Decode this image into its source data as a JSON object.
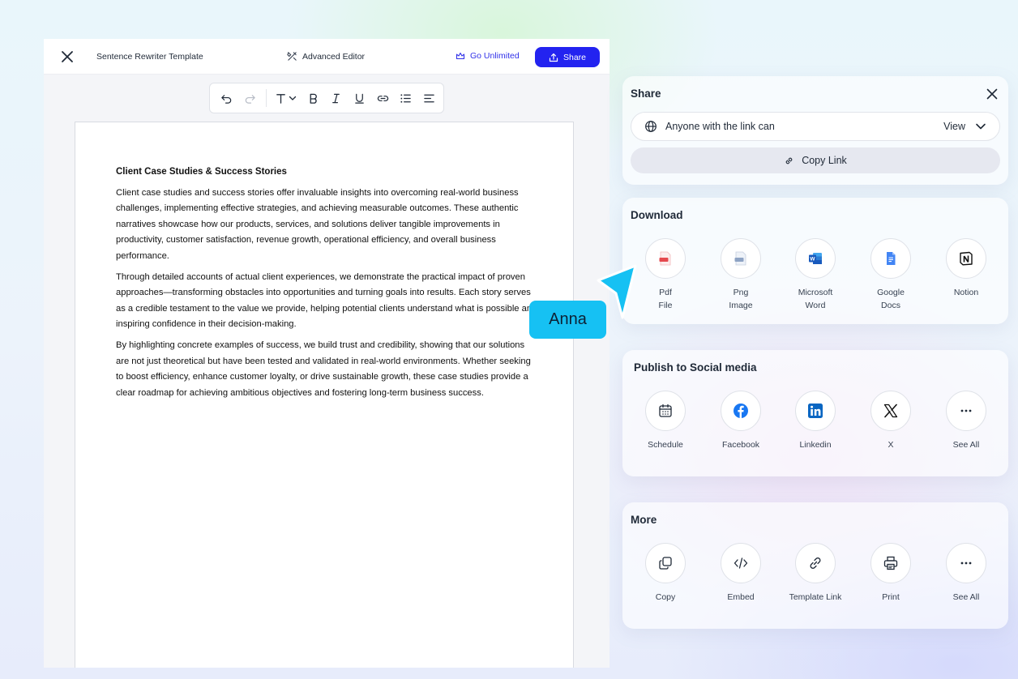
{
  "editor": {
    "doc_title": "Sentence Rewriter Template",
    "advanced_editor": "Advanced Editor",
    "go_unlimited": "Go Unlimited",
    "share": "Share"
  },
  "document": {
    "heading": "Client Case Studies & Success Stories",
    "paragraphs": [
      "Client case studies and success stories offer invaluable insights into overcoming real-world business challenges, implementing effective strategies, and achieving measurable outcomes. These authentic narratives showcase how our products, services, and solutions deliver tangible improvements in productivity, customer satisfaction, revenue growth, operational efficiency, and overall business performance.",
      "Through detailed accounts of actual client experiences, we demonstrate the practical impact of proven approaches—transforming obstacles into opportunities and turning goals into results. Each story serves as a credible testament to the value we provide, helping potential clients understand what is possible and inspiring confidence in their decision-making.",
      "By highlighting concrete examples of success, we build trust and credibility, showing that our solutions are not just theoretical but have been tested and validated in real-world environments. Whether seeking to boost efficiency, enhance customer loyalty, or drive sustainable growth, these case studies provide a clear roadmap for achieving ambitious objectives and fostering long-term business success."
    ]
  },
  "collaborator": {
    "name": "Anna",
    "color": "#16c1f3"
  },
  "share_panel": {
    "title": "Share",
    "access_label": "Anyone with the link can",
    "permission": "View",
    "copy_link": "Copy Link"
  },
  "download_panel": {
    "title": "Download",
    "items": [
      {
        "line1": "Pdf",
        "line2": "File",
        "icon": "pdf-icon"
      },
      {
        "line1": "Png",
        "line2": "Image",
        "icon": "png-icon"
      },
      {
        "line1": "Microsoft",
        "line2": "Word",
        "icon": "word-icon"
      },
      {
        "line1": "Google",
        "line2": "Docs",
        "icon": "google-docs-icon"
      },
      {
        "line1": "Notion",
        "line2": "",
        "icon": "notion-icon"
      }
    ]
  },
  "social_panel": {
    "title": "Publish to Social media",
    "items": [
      {
        "label": "Schedule",
        "icon": "calendar-icon"
      },
      {
        "label": "Facebook",
        "icon": "facebook-icon"
      },
      {
        "label": "Linkedin",
        "icon": "linkedin-icon"
      },
      {
        "label": "X",
        "icon": "x-icon"
      },
      {
        "label": "See All",
        "icon": "more-icon"
      }
    ]
  },
  "more_panel": {
    "title": "More",
    "items": [
      {
        "label": "Copy",
        "icon": "copy-icon"
      },
      {
        "label": "Embed",
        "icon": "embed-icon"
      },
      {
        "label": "Template Link",
        "icon": "link-icon"
      },
      {
        "label": "Print",
        "icon": "print-icon"
      },
      {
        "label": "See All",
        "icon": "more-icon"
      }
    ]
  },
  "colors": {
    "accent": "#2323f0",
    "go_unlimited": "#3030e8",
    "facebook": "#1877f2",
    "linkedin": "#0a66c2",
    "word": "#185abd",
    "google_docs": "#4285f4",
    "pdf": "#e5484d"
  }
}
